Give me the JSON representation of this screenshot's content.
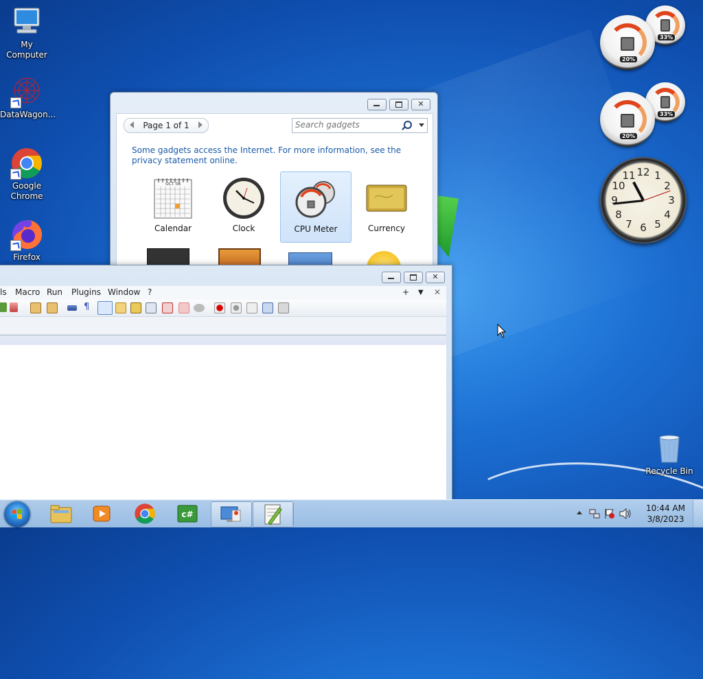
{
  "desktop": {
    "icons": [
      {
        "label": "My Computer"
      },
      {
        "label": "DataWagon..."
      },
      {
        "label": "Google Chrome"
      },
      {
        "label": "Firefox"
      },
      {
        "label": "Recycle Bin"
      }
    ]
  },
  "gadgets": {
    "cpu_meter_1": {
      "cpu": "20%",
      "memory": "33%"
    },
    "cpu_meter_2": {
      "cpu": "20%",
      "memory": "33%"
    },
    "clock_numbers": [
      "12",
      "1",
      "2",
      "3",
      "4",
      "5",
      "6",
      "7",
      "8",
      "9",
      "10",
      "11"
    ]
  },
  "gallery": {
    "page_label": "Page 1 of 1",
    "search_placeholder": "Search gadgets",
    "notice": "Some gadgets access the Internet.  For more information, see the privacy statement online.",
    "items": [
      {
        "label": "Calendar",
        "selected": false
      },
      {
        "label": "Clock",
        "selected": false
      },
      {
        "label": "CPU Meter",
        "selected": true
      },
      {
        "label": "Currency",
        "selected": false
      }
    ],
    "calendar_month": "OCT 08"
  },
  "editor": {
    "menu": [
      "ls",
      "Macro",
      "Run",
      "Plugins",
      "Window",
      "?"
    ],
    "tab_controls": {
      "add": "+",
      "list": "▼",
      "close": "✕"
    }
  },
  "taskbar": {
    "time": "10:44 AM",
    "date": "3/8/2023",
    "colors": {
      "accent": "#2a7fd4"
    }
  }
}
